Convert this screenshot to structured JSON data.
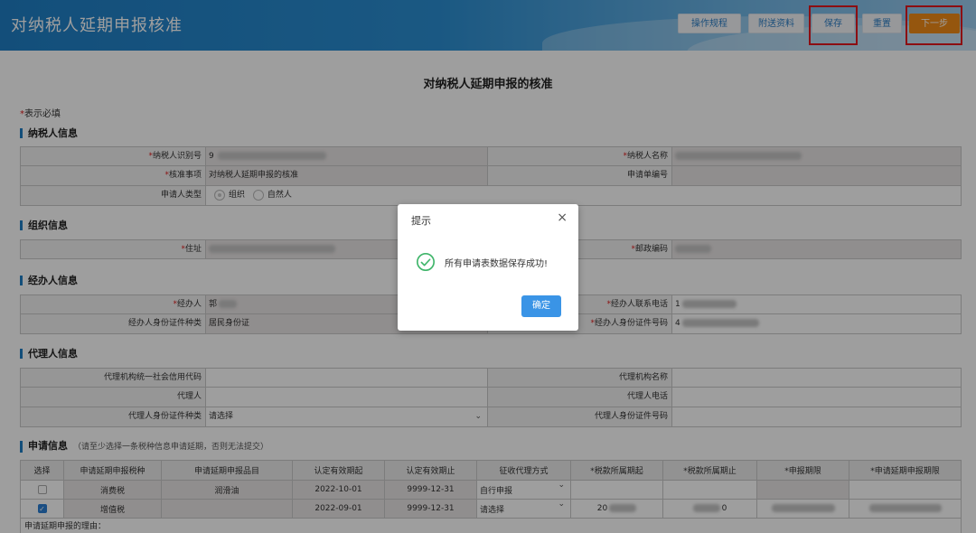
{
  "header": {
    "title": "对纳税人延期申报核准",
    "buttons": {
      "rules": "操作规程",
      "attachments": "附送资料",
      "save": "保存",
      "reset": "重置",
      "next": "下一步"
    }
  },
  "form": {
    "title": "对纳税人延期申报的核准",
    "required_note_star": "*",
    "required_note": "表示必填"
  },
  "sections": {
    "taxpayer": "纳税人信息",
    "org": "组织信息",
    "agent": "经办人信息",
    "proxy": "代理人信息",
    "apply": "申请信息",
    "apply_hint": "（请至少选择一条税种信息申请延期，否则无法提交）"
  },
  "taxpayer": {
    "id_label": "纳税人识别号",
    "id_value": "9",
    "name_label": "纳税人名称",
    "item_label": "核准事项",
    "item_value": "对纳税人延期申报的核准",
    "app_no_label": "申请单编号",
    "applicant_type_label": "申请人类型",
    "applicant_type_options": [
      "组织",
      "自然人"
    ]
  },
  "org": {
    "address_label": "住址",
    "zip_label": "邮政编码"
  },
  "agent": {
    "name_label": "经办人",
    "name_value": "郭",
    "phone_label": "经办人联系电话",
    "phone_value": "1",
    "id_type_label": "经办人身份证件种类",
    "id_type_value": "居民身份证",
    "id_no_label": "经办人身份证件号码",
    "id_no_value": "4"
  },
  "proxy": {
    "org_code_label": "代理机构统一社会信用代码",
    "org_name_label": "代理机构名称",
    "person_label": "代理人",
    "phone_label": "代理人电话",
    "id_type_label": "代理人身份证件种类",
    "id_type_value": "请选择",
    "id_no_label": "代理人身份证件号码"
  },
  "apply_table": {
    "headers": [
      "选择",
      "申请延期申报税种",
      "申请延期申报品目",
      "认定有效期起",
      "认定有效期止",
      "征收代理方式",
      "*税款所属期起",
      "*税款所属期止",
      "*申报期限",
      "*申请延期申报期限"
    ],
    "rows": [
      {
        "checked": false,
        "tax": "消费税",
        "item": "润滑油",
        "start": "2022-10-01",
        "end": "9999-12-31",
        "method": "自行申报",
        "period_start": "",
        "period_end": ""
      },
      {
        "checked": true,
        "tax": "增值税",
        "item": "",
        "start": "2022-09-01",
        "end": "9999-12-31",
        "method": "请选择",
        "period_start": "20",
        "period_end": "0"
      }
    ],
    "reason_label": "申请延期申报的理由："
  },
  "dialog": {
    "title": "提示",
    "message": "所有申请表数据保存成功!",
    "ok": "确定",
    "close_glyph": "×"
  },
  "colors": {
    "header_blue": "#1f7fc6",
    "next_orange": "#f08c17",
    "highlight_red": "#e2171e",
    "ok_blue": "#3a94e6",
    "success_green": "#3fb56a"
  },
  "icons": {
    "close": "close-icon",
    "success": "check-circle-icon",
    "dropdown": "chevron-down-icon"
  }
}
